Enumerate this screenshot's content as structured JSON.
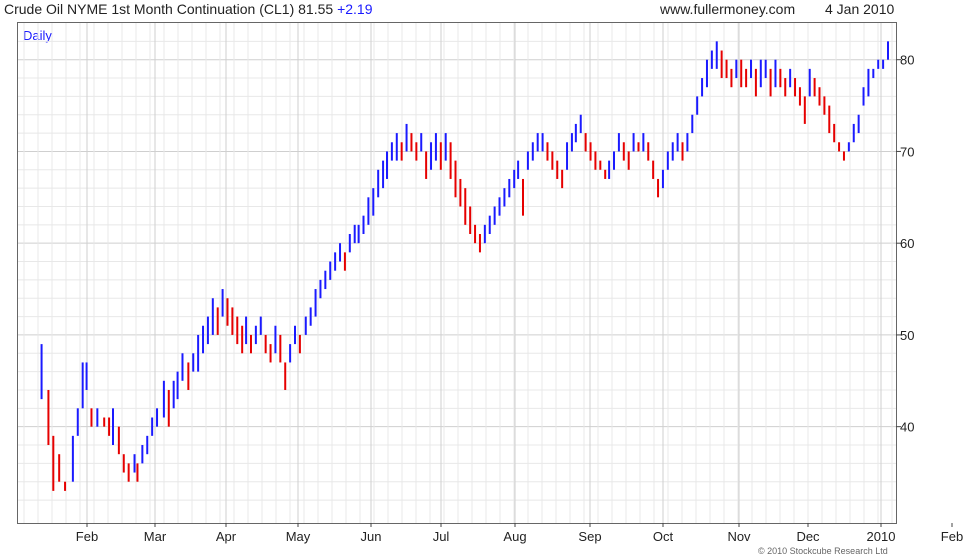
{
  "header": {
    "title": "Crude Oil NYME 1st Month Continuation (CL1) 81.55",
    "change": "+2.19",
    "site": "www.fullermoney.com",
    "date": "4 Jan 2010"
  },
  "period_label": "Daily",
  "footer": "© 2010 Stockcube Research Ltd",
  "colors": {
    "up": "#1a1aff",
    "down": "#e60000",
    "grid": "#cfcfcf",
    "grid_minor": "#e8e8e8"
  },
  "chart_data": {
    "type": "line",
    "subtype": "high-low bars, daily",
    "x_tick_labels": [
      "Feb",
      "Mar",
      "Apr",
      "May",
      "Jun",
      "Jul",
      "Aug",
      "Sep",
      "Oct",
      "Nov",
      "Dec",
      "2010",
      "Feb"
    ],
    "y_tick_labels": [
      "40",
      "50",
      "60",
      "70",
      "80"
    ],
    "ylim": [
      29.5,
      84
    ],
    "x_range": [
      "2009-01-05",
      "2010-02-05"
    ],
    "grid": true,
    "series": [
      {
        "values": [
          [
            20,
            49,
            43
          ],
          [
            27,
            44,
            38
          ],
          [
            32,
            39,
            33
          ],
          [
            38,
            37,
            34
          ],
          [
            44,
            34,
            33
          ],
          [
            52,
            39,
            34
          ],
          [
            57,
            42,
            39
          ],
          [
            62,
            47,
            42
          ],
          [
            66,
            47,
            44
          ],
          [
            71,
            42,
            40
          ],
          [
            77,
            42,
            40
          ],
          [
            84,
            41,
            40
          ],
          [
            89,
            41,
            39
          ],
          [
            93,
            42,
            38
          ],
          [
            99,
            40,
            37
          ],
          [
            104,
            37,
            35
          ],
          [
            109,
            36,
            34
          ],
          [
            115,
            37,
            35
          ],
          [
            118,
            36,
            34
          ],
          [
            123,
            38,
            36
          ],
          [
            128,
            39,
            37
          ],
          [
            133,
            41,
            39
          ],
          [
            138,
            42,
            40
          ],
          [
            145,
            45,
            41
          ],
          [
            150,
            44,
            40
          ],
          [
            155,
            45,
            42
          ],
          [
            159,
            46,
            43
          ],
          [
            164,
            48,
            45
          ],
          [
            170,
            47,
            44
          ],
          [
            175,
            48,
            46
          ],
          [
            180,
            50,
            46
          ],
          [
            185,
            51,
            48
          ],
          [
            190,
            52,
            49
          ],
          [
            195,
            54,
            50
          ],
          [
            200,
            53,
            50
          ],
          [
            205,
            55,
            52
          ],
          [
            210,
            54,
            51
          ],
          [
            215,
            53,
            50
          ],
          [
            220,
            52,
            49
          ],
          [
            225,
            51,
            48
          ],
          [
            229,
            52,
            49
          ],
          [
            234,
            50,
            48
          ],
          [
            239,
            51,
            49
          ],
          [
            244,
            52,
            50
          ],
          [
            249,
            50,
            48
          ],
          [
            254,
            49,
            47
          ],
          [
            259,
            51,
            48
          ],
          [
            264,
            50,
            47
          ],
          [
            269,
            47,
            44
          ],
          [
            274,
            49,
            47
          ],
          [
            279,
            51,
            49
          ],
          [
            284,
            50,
            48
          ],
          [
            290,
            52,
            50
          ],
          [
            295,
            53,
            51
          ],
          [
            300,
            55,
            52
          ],
          [
            305,
            56,
            54
          ],
          [
            310,
            57,
            55
          ],
          [
            315,
            58,
            56
          ],
          [
            320,
            59,
            57
          ],
          [
            325,
            60,
            58
          ],
          [
            330,
            59,
            57
          ],
          [
            335,
            61,
            59
          ],
          [
            340,
            62,
            60
          ],
          [
            344,
            62,
            60
          ],
          [
            349,
            63,
            61
          ],
          [
            354,
            65,
            62
          ],
          [
            359,
            66,
            63
          ],
          [
            364,
            68,
            65
          ],
          [
            369,
            69,
            66
          ],
          [
            373,
            70,
            67
          ],
          [
            378,
            71,
            69
          ],
          [
            383,
            72,
            69
          ],
          [
            388,
            71,
            69
          ],
          [
            393,
            73,
            70
          ],
          [
            398,
            72,
            70
          ],
          [
            403,
            71,
            69
          ],
          [
            408,
            72,
            70
          ],
          [
            413,
            70,
            67
          ],
          [
            418,
            71,
            68
          ],
          [
            423,
            72,
            69
          ],
          [
            428,
            71,
            68
          ],
          [
            433,
            72,
            69
          ],
          [
            438,
            71,
            67
          ],
          [
            443,
            69,
            65
          ],
          [
            448,
            67,
            64
          ],
          [
            453,
            66,
            62
          ],
          [
            458,
            64,
            61
          ],
          [
            463,
            62,
            60
          ],
          [
            468,
            61,
            59
          ],
          [
            473,
            62,
            60
          ],
          [
            478,
            63,
            61
          ],
          [
            483,
            64,
            62
          ],
          [
            488,
            65,
            63
          ],
          [
            493,
            66,
            64
          ],
          [
            498,
            67,
            65
          ],
          [
            503,
            68,
            66
          ],
          [
            507,
            69,
            67
          ],
          [
            512,
            67,
            63
          ],
          [
            517,
            70,
            68
          ],
          [
            522,
            71,
            69
          ],
          [
            527,
            72,
            70
          ],
          [
            532,
            72,
            70
          ],
          [
            537,
            71,
            69
          ],
          [
            542,
            70,
            68
          ],
          [
            547,
            69,
            67
          ],
          [
            552,
            68,
            66
          ],
          [
            557,
            71,
            68
          ],
          [
            562,
            72,
            70
          ],
          [
            566,
            73,
            71
          ],
          [
            571,
            74,
            72
          ],
          [
            576,
            72,
            70
          ],
          [
            581,
            71,
            69
          ],
          [
            586,
            70,
            68
          ],
          [
            591,
            69,
            68
          ],
          [
            596,
            68,
            67
          ],
          [
            600,
            69,
            67
          ],
          [
            605,
            70,
            68
          ],
          [
            610,
            72,
            70
          ],
          [
            615,
            71,
            69
          ],
          [
            620,
            70,
            68
          ],
          [
            625,
            72,
            70
          ],
          [
            630,
            71,
            70
          ],
          [
            635,
            72,
            70
          ],
          [
            640,
            71,
            69
          ],
          [
            645,
            69,
            67
          ],
          [
            650,
            67,
            65
          ],
          [
            655,
            68,
            66
          ],
          [
            660,
            70,
            68
          ],
          [
            665,
            71,
            69
          ],
          [
            670,
            72,
            70
          ],
          [
            675,
            71,
            69
          ],
          [
            680,
            72,
            70
          ],
          [
            685,
            74,
            72
          ],
          [
            690,
            76,
            74
          ],
          [
            695,
            78,
            76
          ],
          [
            700,
            80,
            77
          ],
          [
            705,
            81,
            79
          ],
          [
            710,
            82,
            79
          ],
          [
            715,
            81,
            78
          ],
          [
            720,
            80,
            78
          ],
          [
            725,
            79,
            77
          ],
          [
            730,
            80,
            78
          ],
          [
            735,
            80,
            77
          ],
          [
            740,
            79,
            77
          ],
          [
            745,
            80,
            78
          ],
          [
            750,
            79,
            76
          ],
          [
            755,
            80,
            77
          ],
          [
            760,
            80,
            78
          ],
          [
            765,
            79,
            76
          ],
          [
            770,
            80,
            77
          ],
          [
            775,
            79,
            77
          ],
          [
            780,
            78,
            76
          ],
          [
            785,
            79,
            77
          ],
          [
            790,
            78,
            76
          ],
          [
            795,
            77,
            75
          ],
          [
            800,
            76,
            73
          ],
          [
            805,
            79,
            76
          ],
          [
            810,
            78,
            76
          ],
          [
            815,
            77,
            75
          ],
          [
            820,
            76,
            74
          ],
          [
            825,
            75,
            72
          ],
          [
            830,
            73,
            71
          ],
          [
            835,
            71,
            70
          ],
          [
            840,
            70,
            69
          ],
          [
            845,
            71,
            70
          ],
          [
            850,
            73,
            71
          ],
          [
            855,
            74,
            72
          ],
          [
            860,
            77,
            75
          ],
          [
            865,
            79,
            76
          ],
          [
            870,
            79,
            78
          ],
          [
            875,
            80,
            79
          ],
          [
            880,
            80,
            79
          ],
          [
            885,
            82,
            80
          ]
        ]
      }
    ]
  }
}
